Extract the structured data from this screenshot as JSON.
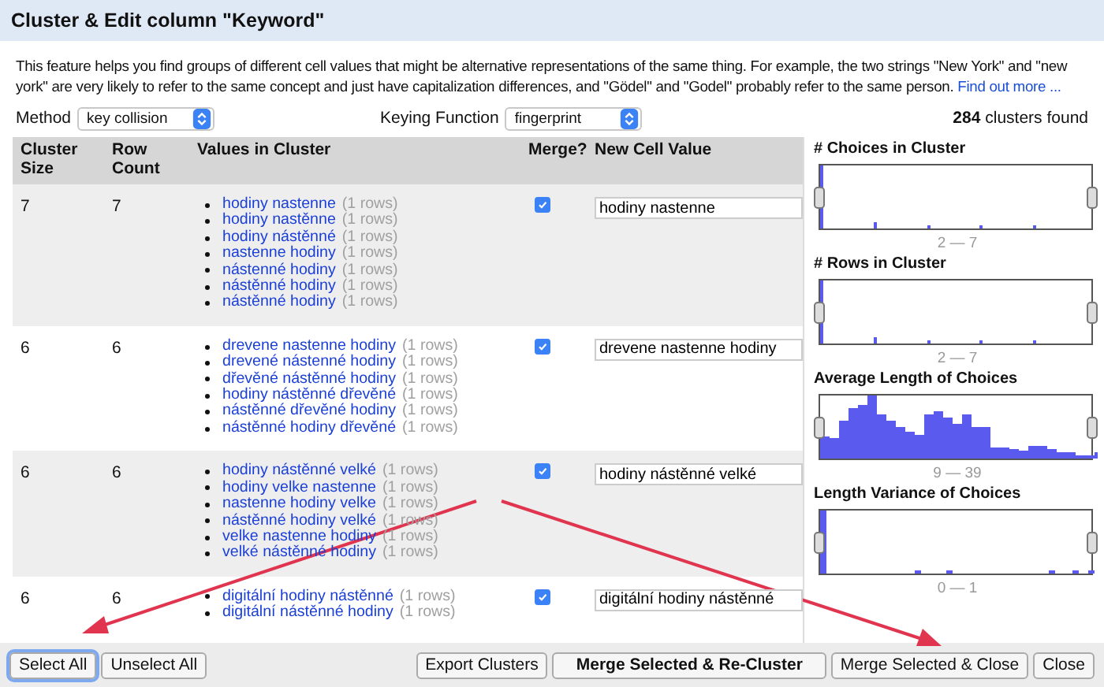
{
  "dialog": {
    "title": "Cluster & Edit column \"Keyword\""
  },
  "description": {
    "text": "This feature helps you find groups of different cell values that might be alternative representations of the same thing. For example, the two strings \"New York\" and \"new york\" are very likely to refer to the same concept and just have capitalization differences, and \"Gödel\" and \"Godel\" probably refer to the same person.",
    "link": "Find out more ..."
  },
  "method": {
    "label": "Method",
    "value": "key collision"
  },
  "keying_function": {
    "label": "Keying Function",
    "value": "fingerprint"
  },
  "clusters_found": {
    "count": "284",
    "label": "clusters found"
  },
  "table": {
    "columns": [
      "Cluster Size",
      "Row Count",
      "Values in Cluster",
      "Merge?",
      "New Cell Value"
    ],
    "rows": [
      {
        "cluster_size": "7",
        "row_count": "7",
        "merge": true,
        "new_value": "hodiny nastenne",
        "values": [
          {
            "value": "hodiny nastenne",
            "count": "(1 rows)"
          },
          {
            "value": "hodiny nastěnne",
            "count": "(1 rows)"
          },
          {
            "value": "hodiny nástěnné",
            "count": "(1 rows)"
          },
          {
            "value": "nastenne hodiny",
            "count": "(1 rows)"
          },
          {
            "value": "nástenné hodiny",
            "count": "(1 rows)"
          },
          {
            "value": "nástěnné hodiny",
            "count": "(1 rows)"
          },
          {
            "value": "nástěnné hodiny",
            "count": "(1 rows)"
          }
        ]
      },
      {
        "cluster_size": "6",
        "row_count": "6",
        "merge": true,
        "new_value": "drevene nastenne hodiny",
        "values": [
          {
            "value": "drevene nastenne hodiny",
            "count": "(1 rows)"
          },
          {
            "value": "drevené nástenné hodiny",
            "count": "(1 rows)"
          },
          {
            "value": "dřevěné nástěnné hodiny",
            "count": "(1 rows)"
          },
          {
            "value": "hodiny nástěnné dřevěné",
            "count": "(1 rows)"
          },
          {
            "value": "nástěnné dřevěné hodiny",
            "count": "(1 rows)"
          },
          {
            "value": "nástěnné hodiny dřevěné",
            "count": "(1 rows)"
          }
        ]
      },
      {
        "cluster_size": "6",
        "row_count": "6",
        "merge": true,
        "new_value": "hodiny nástěnné velké",
        "values": [
          {
            "value": "hodiny nástěnné velké",
            "count": "(1 rows)"
          },
          {
            "value": "hodiny velke nastenne",
            "count": "(1 rows)"
          },
          {
            "value": "nastenne hodiny velke",
            "count": "(1 rows)"
          },
          {
            "value": "nástěnné hodiny velké",
            "count": "(1 rows)"
          },
          {
            "value": "velke nastenne hodiny",
            "count": "(1 rows)"
          },
          {
            "value": "velké nástěnné hodiny",
            "count": "(1 rows)"
          }
        ]
      },
      {
        "cluster_size": "6",
        "row_count": "6",
        "merge": true,
        "new_value": "digitální hodiny nástěnné",
        "values": [
          {
            "value": "digitální hodiny nástěnné",
            "count": "(1 rows)"
          },
          {
            "value": "digitální nástěnné hodiny",
            "count": "(1 rows)"
          }
        ]
      }
    ]
  },
  "facets": [
    {
      "title": "# Choices in Cluster",
      "range": "2 — 7"
    },
    {
      "title": "# Rows in Cluster",
      "range": "2 — 7"
    },
    {
      "title": "Average Length of Choices",
      "range": "9 — 39"
    },
    {
      "title": "Length Variance of Choices",
      "range": "0 — 1"
    }
  ],
  "buttons_left": [
    {
      "label": "Select All",
      "focused": true
    },
    {
      "label": "Unselect All",
      "focused": false
    }
  ],
  "buttons_right": [
    {
      "label": "Export Clusters",
      "bold": false
    },
    {
      "label": "Merge Selected & Re-Cluster",
      "bold": true
    },
    {
      "label": "Merge Selected & Close",
      "bold": false
    },
    {
      "label": "Close",
      "bold": false
    }
  ]
}
